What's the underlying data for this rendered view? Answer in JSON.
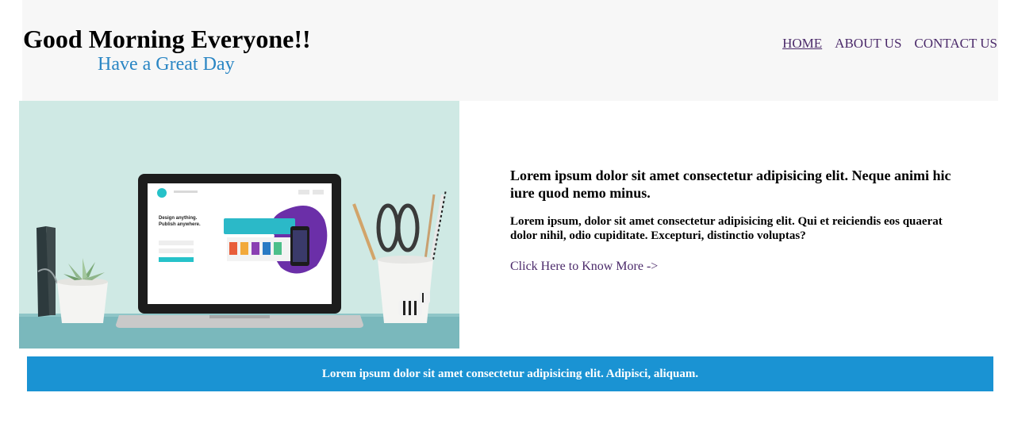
{
  "header": {
    "title": "Good Morning Everyone!!",
    "subtitle": "Have a Great Day",
    "nav": {
      "home": "HOME",
      "about": "ABOUT US",
      "contact": "CONTACT US"
    }
  },
  "hero": {
    "image_description": "laptop-on-desk-image",
    "laptop_screen": {
      "headline_line1": "Design anything.",
      "headline_line2": "Publish anywhere."
    },
    "heading": "Lorem ipsum dolor sit amet consectetur adipisicing elit. Neque animi hic iure quod nemo minus.",
    "body": "Lorem ipsum, dolor sit amet consectetur adipisicing elit. Qui et reiciendis eos quaerat dolor nihil, odio cupiditate. Excepturi, distinctio voluptas?",
    "link": "Click Here to Know More ->"
  },
  "banner": {
    "text": "Lorem ipsum dolor sit amet consectetur adipisicing elit. Adipisci, aliquam."
  },
  "colors": {
    "header_bg": "#f7f7f7",
    "subtitle": "#2a86c4",
    "nav_link": "#4b2a6a",
    "banner_bg": "#1a93d3"
  }
}
